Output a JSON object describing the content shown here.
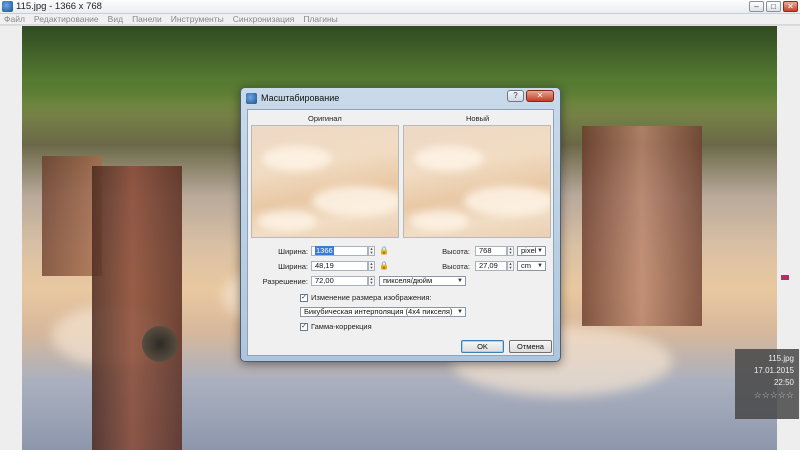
{
  "window": {
    "title": "115.jpg  -  1366 x 768",
    "controls": {
      "minimize": "–",
      "maximize": "□",
      "close": "✕"
    }
  },
  "menu": {
    "items": [
      "Файл",
      "Редактирование",
      "Вид",
      "Панели",
      "Инструменты",
      "Синхронизация",
      "Плагины"
    ]
  },
  "dialog": {
    "title": "Масштабирование",
    "help_label": "?",
    "close_label": "✕",
    "original_header": "Оригинал",
    "new_header": "Новый",
    "width_px_label": "Ширина:",
    "width_px_value": "1366",
    "width_cm_label": "Ширина:",
    "width_cm_value": "48,19",
    "height_px_label": "Высота:",
    "height_px_value": "768",
    "height_cm_label": "Высота:",
    "height_cm_value": "27,09",
    "unit_px": "pixel",
    "unit_cm": "cm",
    "resolution_label": "Разрешение:",
    "resolution_value": "72,00",
    "resolution_unit": "пикселя/дюйм",
    "resize_checkbox_label": "Изменение размера изображения:",
    "resize_checked": true,
    "interpolation": "Бикубическая интерполяция (4x4 пикселя)",
    "gamma_checkbox_label": "Гамма-коррекция",
    "gamma_checked": true,
    "ok_label": "OK",
    "cancel_label": "Отмена"
  },
  "info_panel": {
    "filename": "115.jpg",
    "datetime": "17.01.2015 22:50",
    "rating": "☆☆☆☆☆"
  }
}
